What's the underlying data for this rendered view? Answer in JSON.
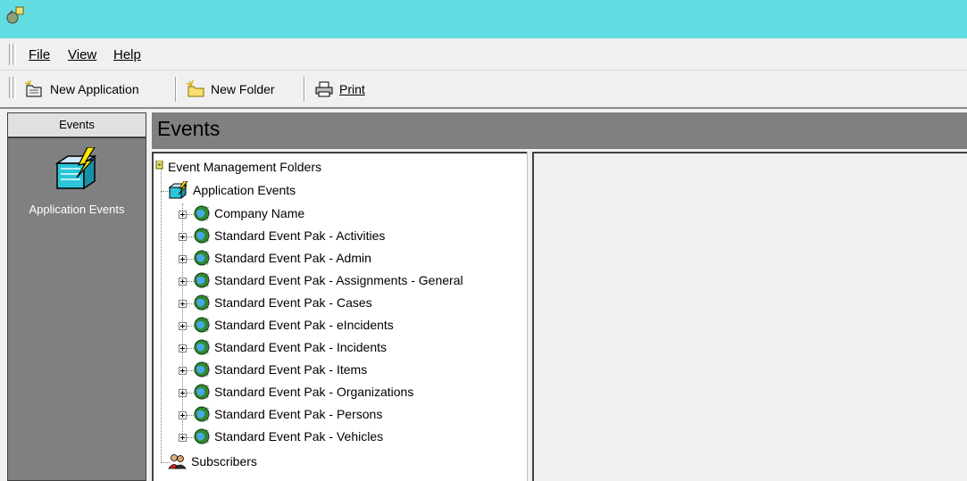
{
  "menu": {
    "file": "File",
    "view": "View",
    "help": "Help"
  },
  "toolbar": {
    "new_application": "New Application",
    "new_folder": "New Folder",
    "print": "Print"
  },
  "outlook_bar": {
    "header": "Events",
    "item_label": "Application Events"
  },
  "main": {
    "title": "Events"
  },
  "tree": {
    "root": "Event Management Folders",
    "application_events": "Application Events",
    "children": [
      "Company Name",
      "Standard Event Pak - Activities",
      "Standard Event Pak - Admin",
      "Standard Event Pak - Assignments - General",
      "Standard Event Pak - Cases",
      "Standard Event Pak - eIncidents",
      "Standard Event Pak - Incidents",
      "Standard Event Pak - Items",
      "Standard Event Pak - Organizations",
      "Standard Event Pak - Persons",
      "Standard Event Pak - Vehicles"
    ],
    "subscribers": "Subscribers"
  },
  "colors": {
    "titlebar": "#63dde1",
    "panel_gray": "#808080"
  }
}
